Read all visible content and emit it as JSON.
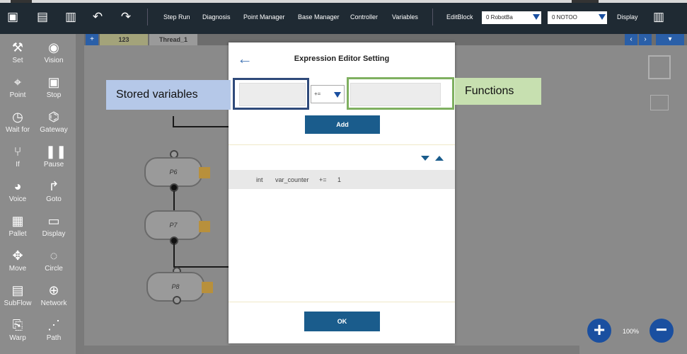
{
  "toolbar": {
    "items": [
      "Step Run",
      "Diagnosis",
      "Point Manager",
      "Base Manager",
      "Controller",
      "Variables",
      "EditBlock"
    ],
    "robot_base_select": "0 RobotBa",
    "tool_select": "0 NOTOO",
    "display_label": "Display"
  },
  "palette": {
    "items": [
      {
        "label": "Set",
        "icon": "wrench-icon"
      },
      {
        "label": "Vision",
        "icon": "eye-icon"
      },
      {
        "label": "Point",
        "icon": "point-icon"
      },
      {
        "label": "Stop",
        "icon": "stop-icon"
      },
      {
        "label": "Wait for",
        "icon": "clock-icon"
      },
      {
        "label": "Gateway",
        "icon": "gateway-icon"
      },
      {
        "label": "If",
        "icon": "branch-icon"
      },
      {
        "label": "Pause",
        "icon": "pause-icon"
      },
      {
        "label": "Voice",
        "icon": "voice-icon"
      },
      {
        "label": "Goto",
        "icon": "goto-icon"
      },
      {
        "label": "Pallet",
        "icon": "grid-icon"
      },
      {
        "label": "Display",
        "icon": "display-icon"
      },
      {
        "label": "Move",
        "icon": "move-icon"
      },
      {
        "label": "Circle",
        "icon": "circle-icon"
      },
      {
        "label": "SubFlow",
        "icon": "subflow-icon"
      },
      {
        "label": "Network",
        "icon": "globe-icon"
      },
      {
        "label": "Warp",
        "icon": "warp-icon"
      },
      {
        "label": "Path",
        "icon": "path-icon"
      }
    ]
  },
  "tabs": [
    {
      "label": "123"
    },
    {
      "label": "Thread_1"
    }
  ],
  "flow_nodes": [
    {
      "label": "P6"
    },
    {
      "label": "P7"
    },
    {
      "label": "P8"
    }
  ],
  "zoom": {
    "level": "100%"
  },
  "modal": {
    "title": "Expression Editor Setting",
    "operator": "+=",
    "add_label": "Add",
    "ok_label": "OK",
    "expression": {
      "type": "int",
      "name": "var_counter",
      "op": "+=",
      "value": "1"
    }
  },
  "annotations": {
    "stored_variables": "Stored variables",
    "functions": "Functions"
  }
}
